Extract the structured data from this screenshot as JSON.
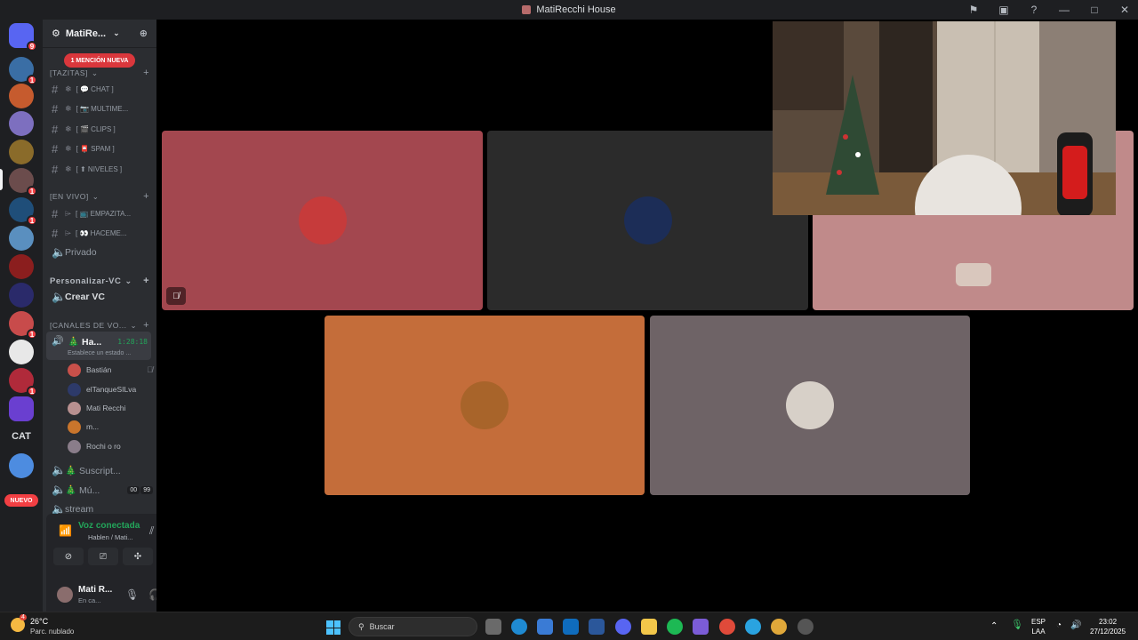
{
  "window": {
    "title": "MatiRecchi House"
  },
  "server": {
    "name": "MatiRe...",
    "mention_banner": "1 MENCIÓN NUEVA",
    "categories": {
      "tazitas": "[TAZITAS]",
      "en_vivo": "[EN VIVO]",
      "personalizar": "Personalizar-VC",
      "canales_voz": "[CANALES DE VO..."
    },
    "text_channels": [
      {
        "label": "[ 💬 CHAT ]"
      },
      {
        "label": "[ 📷 MULTIME..."
      },
      {
        "label": "[ 🎬 CLIPS ]"
      },
      {
        "label": "[ 📮 SPAM ]"
      },
      {
        "label": "[ ⬆ NIVELES ]"
      }
    ],
    "live_channels": [
      {
        "label": "[ 📺 EMPAZITA..."
      },
      {
        "label": "[ 👀 HACEME..."
      }
    ],
    "privado": "Privado",
    "crear_vc": "Crear VC",
    "active_vc": {
      "name": "🎄 Ha...",
      "timer": "1:28:18",
      "status": "Establece un estado ..."
    },
    "members": [
      {
        "name": "Bastián",
        "color": "#c8504a"
      },
      {
        "name": "elTanqueSILva",
        "color": "#2d3a6a"
      },
      {
        "name": "Mati Recchi",
        "color": "#b89090"
      },
      {
        "name": "m...",
        "color": "#c9752c"
      },
      {
        "name": "Rochi o ro",
        "color": "#8a7d8a"
      }
    ],
    "other_vcs": [
      {
        "name": "🎄 Suscript..."
      },
      {
        "name": "🎄 Mú...",
        "counts": [
          "00",
          "99"
        ]
      },
      {
        "name": "stream"
      }
    ]
  },
  "guilds": {
    "items": [
      {
        "color": "#5865f2",
        "badge": "9"
      },
      {
        "color": "#3a6ea5",
        "badge": "1"
      },
      {
        "color": "#c65b2e",
        "badge": ""
      },
      {
        "color": "#7d6fbf",
        "badge": ""
      },
      {
        "color": "#8a6b2a",
        "badge": ""
      },
      {
        "color": "#6b4c4c",
        "badge": "1"
      },
      {
        "color": "#1f4e79",
        "badge": "1"
      },
      {
        "color": "#5a8fbf",
        "badge": ""
      },
      {
        "color": "#8b1e1e",
        "badge": ""
      },
      {
        "color": "#2a2a6a",
        "badge": ""
      },
      {
        "color": "#c84b4b",
        "badge": "1"
      },
      {
        "color": "#e8e8e8",
        "badge": ""
      },
      {
        "color": "#b02a3a",
        "badge": "1"
      },
      {
        "color": "#6a3fd0",
        "badge": ""
      }
    ],
    "cat_label": "CAT",
    "nuevo_label": "NUEVO",
    "last_item_color": "#4d8ce0"
  },
  "voice_panel": {
    "connected": "Voz conectada",
    "channel": "Hablen / Mati...",
    "user_name": "Mati R...",
    "user_status": "En ca..."
  },
  "stage": {
    "tiles": [
      {
        "bg": "#a3474f",
        "avatar": "#c63b3b",
        "muted": true
      },
      {
        "bg": "#2b2b2b",
        "avatar": "#1c2d57",
        "muted": false
      },
      {
        "bg": "#c08a8a",
        "avatar": "#d9c7bd",
        "muted": false
      },
      {
        "bg": "#c46d3a",
        "avatar": "#a8642a",
        "muted": false
      },
      {
        "bg": "#6e6366",
        "avatar": "#d7d0c8",
        "muted": false
      }
    ]
  },
  "taskbar": {
    "weather_temp": "26°C",
    "weather_desc": "Parc. nublado",
    "weather_badge": "4",
    "search_placeholder": "Buscar",
    "lang": "ESP",
    "layout": "LAA",
    "time": "23:02",
    "date": "27/12/2025"
  }
}
